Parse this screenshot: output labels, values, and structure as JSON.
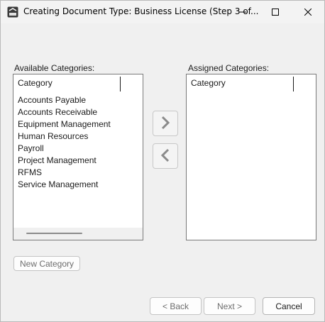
{
  "window": {
    "title": "Creating Document Type: Business License (Step 3 of...",
    "app_icon": "app-logo-icon",
    "controls": [
      "minimize-icon",
      "maximize-icon",
      "close-icon"
    ]
  },
  "available": {
    "label": "Available Categories:",
    "column_header": "Category",
    "items": [
      "Accounts Payable",
      "Accounts Receivable",
      "Equipment Management",
      "Human Resources",
      "Payroll",
      "Project Management",
      "RFMS",
      "Service Management"
    ]
  },
  "assigned": {
    "label": "Assigned Categories:",
    "column_header": "Category",
    "items": []
  },
  "actions": {
    "add_icon": "chevron-right-icon",
    "remove_icon": "chevron-left-icon",
    "new_category_label": "New Category"
  },
  "footer": {
    "back_label": "< Back",
    "next_label": "Next >",
    "cancel_label": "Cancel"
  },
  "colors": {
    "window_bg": "#f0f0f0",
    "list_bg": "#ffffff",
    "disabled_text": "#6d6d6d",
    "arrow_gray": "#8a8a8a"
  }
}
